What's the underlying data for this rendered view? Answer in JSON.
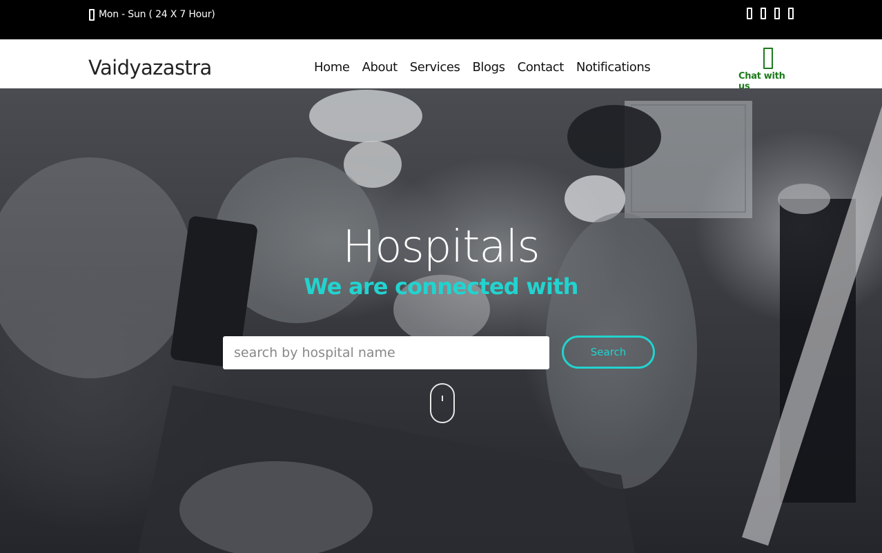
{
  "topbar": {
    "hours": "Mon - Sun ( 24 X 7 Hour)",
    "social_icons": [
      "social-icon-1",
      "social-icon-2",
      "social-icon-3",
      "social-icon-4"
    ]
  },
  "nav": {
    "brand": "Vaidyazastra",
    "items": [
      "Home",
      "About",
      "Services",
      "Blogs",
      "Contact",
      "Notifications"
    ],
    "chat_label": "Chat with us"
  },
  "hero": {
    "title": "Hospitals",
    "subtitle": "We are connected with",
    "search_placeholder": "search by hospital name",
    "search_button": "Search"
  },
  "colors": {
    "accent": "#22d3cf",
    "chat_green": "#1c7a1c",
    "topbar_bg": "#000000",
    "nav_bg": "#ffffff"
  }
}
